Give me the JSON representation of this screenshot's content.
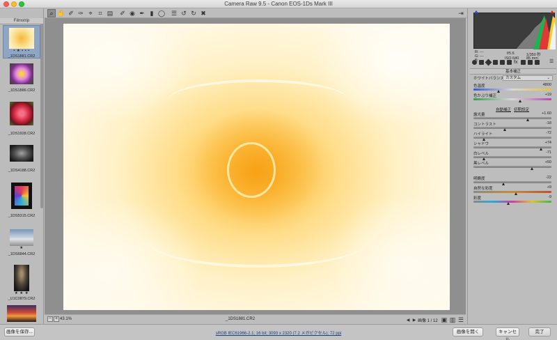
{
  "window": {
    "title": "Camera Raw 9.5  -  Canon EOS-1Ds Mark III"
  },
  "toolbar": {
    "tools": [
      "zoom-tool",
      "hand-tool",
      "white-balance-tool",
      "color-sampler-tool",
      "targeted-adjustment-tool",
      "crop-tool",
      "straighten-tool",
      "spot-removal-tool",
      "red-eye-tool",
      "adjustment-brush-tool",
      "graduated-filter-tool",
      "radial-filter-tool",
      "preferences",
      "rotate-left",
      "rotate-right",
      "trash"
    ]
  },
  "filmstrip": {
    "header": "Filmstrip",
    "items": [
      {
        "name": "_1DS1881.CR2",
        "stars": "• ★ • • •",
        "color": "#f7e07a",
        "selected": true
      },
      {
        "name": "_1DS1886.CR2",
        "stars": "",
        "color": "#c562c8",
        "selected": false
      },
      {
        "name": "_1DS1928.CR2",
        "stars": "",
        "color": "#d9344a",
        "selected": false
      },
      {
        "name": "_1DS4188.CR2",
        "stars": "",
        "color": "#555555",
        "selected": false
      },
      {
        "name": "_1DS5315.CR2",
        "stars": "",
        "color": "#3b2f5e",
        "selected": false
      },
      {
        "name": "_1DS6844.CR2",
        "stars": "★",
        "color": "#a9b9c9",
        "selected": false
      },
      {
        "name": "_U1C0879.CR2",
        "stars": "★ ★ ★",
        "color": "#6a655c",
        "selected": false
      },
      {
        "name": "",
        "stars": "",
        "color": "#c15a3a",
        "selected": false
      }
    ]
  },
  "preview": {
    "zoom": "43.1%",
    "filename": "_1DS1881.CR2",
    "page": "画像 1 / 12"
  },
  "histogram": {
    "rgb_labels": [
      "R:",
      "G:",
      "B:"
    ],
    "rgb_values": [
      "---",
      "---",
      "---"
    ],
    "aperture": "f/5.6",
    "shutter": "1/350 秒",
    "iso": "ISO 640",
    "focal": "85 mm"
  },
  "panel": {
    "section": "基本補正",
    "wb_label": "ホワイトバランス：",
    "wb_value": "カスタム",
    "auto": "自動補正",
    "default": "初期設定",
    "sliders": [
      {
        "label": "色温度",
        "value": "4800",
        "pos": 0.33,
        "gradient": "linear-gradient(90deg,#3b55c6,#d9d9d9,#e3c145)"
      },
      {
        "label": "色かぶり補正",
        "value": "+19",
        "pos": 0.6,
        "gradient": "linear-gradient(90deg,#31a34a,#d9d9d9,#c140b8)"
      },
      {
        "label": "露光量",
        "value": "+1.60",
        "pos": 0.7,
        "gradient": ""
      },
      {
        "label": "コントラスト",
        "value": "-18",
        "pos": 0.41,
        "gradient": ""
      },
      {
        "label": "ハイライト",
        "value": "-72",
        "pos": 0.14,
        "gradient": ""
      },
      {
        "label": "シャドウ",
        "value": "+74",
        "pos": 0.87,
        "gradient": ""
      },
      {
        "label": "白レベル",
        "value": "-71",
        "pos": 0.14,
        "gradient": ""
      },
      {
        "label": "黒レベル",
        "value": "+50",
        "pos": 0.75,
        "gradient": ""
      },
      {
        "label": "明瞭度",
        "value": "-22",
        "pos": 0.39,
        "gradient": ""
      },
      {
        "label": "自然な彩度",
        "value": "+9",
        "pos": 0.55,
        "gradient": "linear-gradient(90deg,#888,#c48d38,#c24e2d)"
      },
      {
        "label": "彩度",
        "value": "-9",
        "pos": 0.45,
        "gradient": "linear-gradient(90deg,#888,#2fa9d6,#c93fa7,#d8c62e,#47b14a)"
      }
    ]
  },
  "footer": {
    "save": "画像を保存...",
    "workflow": "sRGB IEC61966-2.1; 16 bit; 3093 x 2320 (7.2 メガピクセル); 72 ppi",
    "open": "画像を開く",
    "cancel": "キャンセル",
    "done": "完了"
  }
}
